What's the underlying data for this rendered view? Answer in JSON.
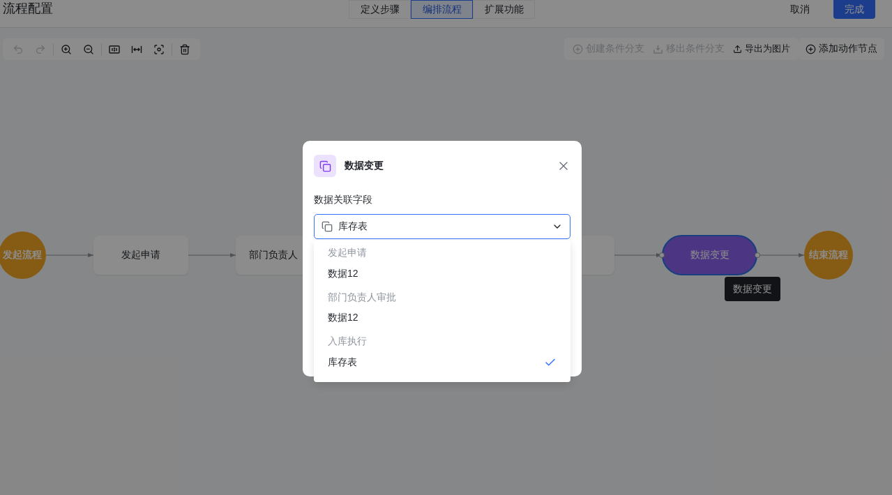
{
  "header": {
    "title": "流程配置",
    "tabs": [
      {
        "label": "定义步骤",
        "selected": false
      },
      {
        "label": "编排流程",
        "selected": true
      },
      {
        "label": "扩展功能",
        "selected": false
      }
    ],
    "buttons": [
      {
        "label": "取消",
        "kind": "default"
      },
      {
        "label": "完成",
        "kind": "primary"
      }
    ]
  },
  "toolbar": {
    "tools": [
      {
        "kind": "undo",
        "disabled": true
      },
      {
        "kind": "redo",
        "disabled": true
      },
      {
        "kind": "zoom-in",
        "disabled": false
      },
      {
        "kind": "zoom-out",
        "disabled": false
      },
      {
        "kind": "actual-size",
        "disabled": false
      },
      {
        "kind": "fit-width",
        "disabled": false
      },
      {
        "kind": "focus",
        "disabled": false
      },
      {
        "kind": "delete",
        "disabled": false
      }
    ],
    "actions": [
      {
        "kind": "add",
        "label": "创建条件分支",
        "disabled": true
      },
      {
        "kind": "remove",
        "label": "移出条件分支",
        "disabled": true
      },
      {
        "kind": "export",
        "label": "导出为图片",
        "disabled": false
      }
    ],
    "add_node_button": {
      "label": "添加动作节点"
    }
  },
  "flow": {
    "nodes": [
      {
        "kind": "start",
        "label": "发起流程",
        "selected": false
      },
      {
        "kind": "task",
        "label": "发起申请",
        "selected": false
      },
      {
        "kind": "task",
        "label": "部门负责人",
        "selected": false
      },
      {
        "kind": "task",
        "selected": false
      },
      {
        "kind": "action",
        "label": "数据变更",
        "selected": true
      },
      {
        "kind": "end",
        "label": "结束流程",
        "selected": false
      }
    ],
    "tooltip": "数据变更"
  },
  "dialog": {
    "title": "数据变更",
    "field_label": "数据关联字段",
    "select": {
      "value": "库存表"
    },
    "dropdown": {
      "groups": [
        {
          "label": "发起申请",
          "options": [
            {
              "label": "数据12",
              "selected": false
            }
          ]
        },
        {
          "label": "部门负责人审批",
          "options": [
            {
              "label": "数据12",
              "selected": false
            }
          ]
        },
        {
          "label": "入库执行",
          "options": [
            {
              "label": "库存表",
              "selected": true
            }
          ]
        }
      ]
    }
  }
}
